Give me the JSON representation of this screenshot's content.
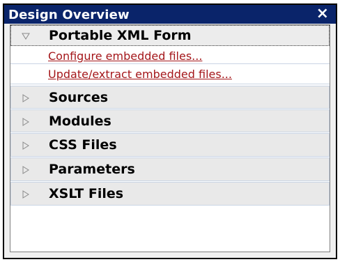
{
  "window": {
    "title": "Design Overview",
    "close_glyph": "×"
  },
  "tree": {
    "expanded_section": {
      "label": "Portable XML Form",
      "icon": "expanded-triangle-icon",
      "links": [
        "Configure embedded files...",
        "Update/extract embedded files..."
      ]
    },
    "collapsed_sections": [
      "Sources",
      "Modules",
      "CSS Files",
      "Parameters",
      "XSLT Files"
    ]
  },
  "colors": {
    "titlebar": "#0a246a",
    "link": "#a4161a",
    "header_bg": "#e9e9e9"
  }
}
